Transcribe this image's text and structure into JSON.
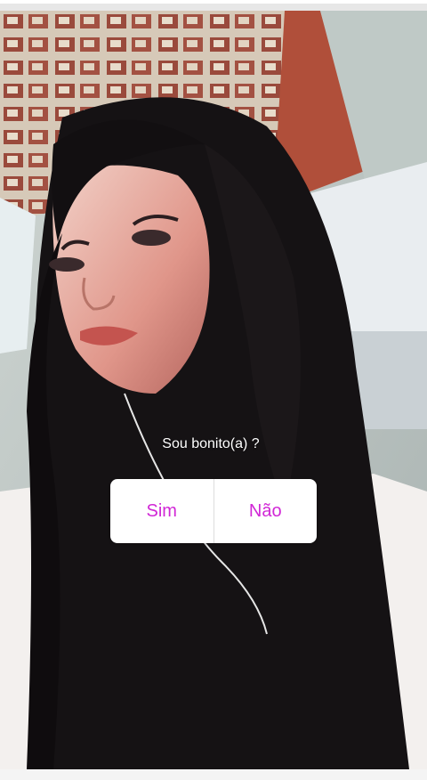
{
  "story": {
    "poll": {
      "question": "Sou bonito(a) ?",
      "options": [
        "Sim",
        "Não"
      ],
      "option_color": "#d127d6"
    }
  }
}
